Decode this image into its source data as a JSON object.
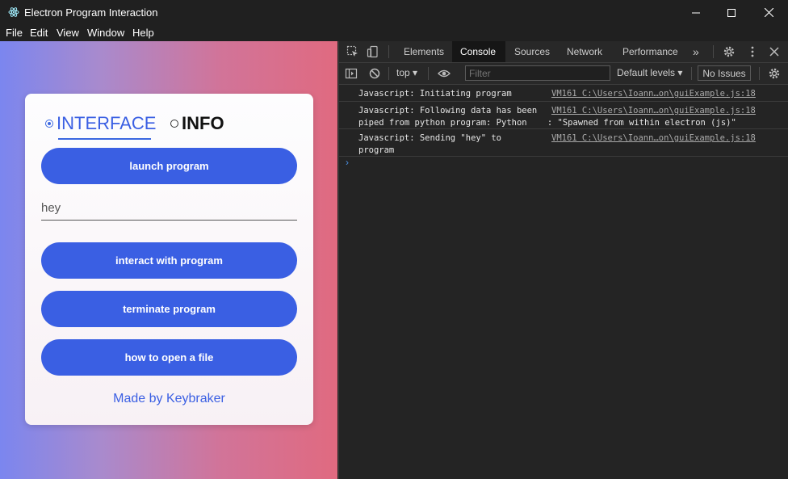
{
  "window": {
    "title": "Electron Program Interaction",
    "controls": [
      "minimize",
      "maximize",
      "close"
    ]
  },
  "menubar": {
    "items": [
      "File",
      "Edit",
      "View",
      "Window",
      "Help"
    ]
  },
  "app": {
    "tabs": [
      {
        "label": "INTERFACE",
        "selected": true
      },
      {
        "label": "INFO",
        "selected": false
      }
    ],
    "launch_label": "launch program",
    "input_value": "hey",
    "interact_label": "interact with program",
    "terminate_label": "terminate program",
    "open_file_label": "how to open a file",
    "footer": "Made by Keybraker",
    "accent_color": "#3a5fe3"
  },
  "devtools": {
    "tabs": [
      {
        "label": "Elements",
        "active": false
      },
      {
        "label": "Console",
        "active": true
      },
      {
        "label": "Sources",
        "active": false
      },
      {
        "label": "Network",
        "active": false
      },
      {
        "label": "Performance",
        "active": false
      }
    ],
    "more_tabs": "»",
    "toolbar": {
      "context": "top",
      "filter_placeholder": "Filter",
      "levels": "Default levels",
      "issues": "No Issues"
    },
    "logs": [
      {
        "message": "Javascript: Initiating program",
        "source": "VM161 C:\\Users\\Ioann…on\\guiExample.js:18"
      },
      {
        "message": "Javascript: Following data has been\npiped from python program: Python    : \"Spawned from within electron (js)\"",
        "source": "VM161 C:\\Users\\Ioann…on\\guiExample.js:18"
      },
      {
        "message": "Javascript: Sending \"hey\" to\nprogram",
        "source": "VM161 C:\\Users\\Ioann…on\\guiExample.js:18"
      }
    ],
    "prompt": "›"
  }
}
